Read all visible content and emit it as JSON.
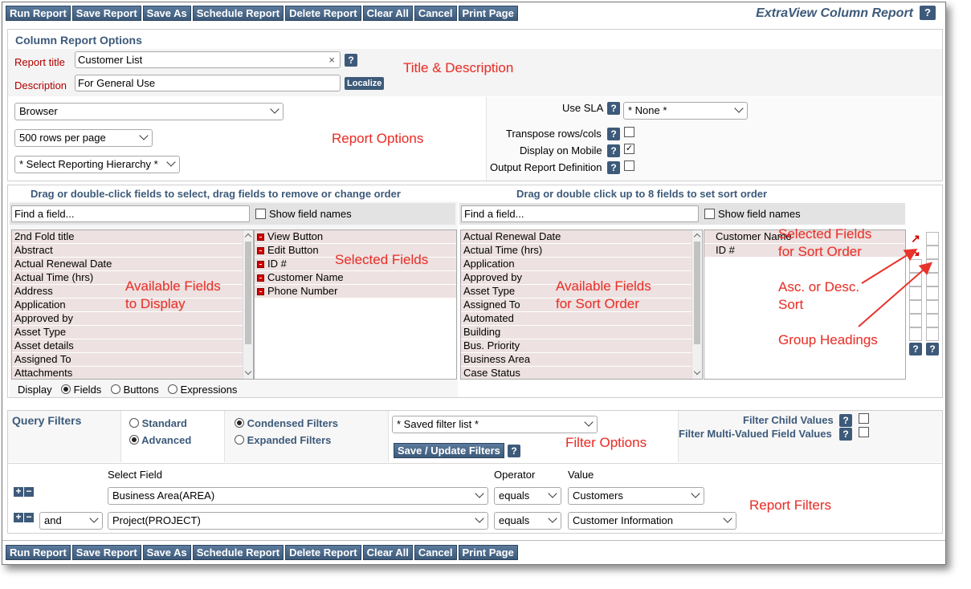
{
  "toolbar": {
    "buttons": [
      "Run Report",
      "Save Report",
      "Save As",
      "Schedule Report",
      "Delete Report",
      "Clear All",
      "Cancel",
      "Print Page"
    ]
  },
  "page_title": "ExtraView Column Report",
  "help_label": "?",
  "options": {
    "title": "Column Report Options",
    "report_title_label": "Report title",
    "report_title_value": "Customer List",
    "description_label": "Description",
    "description_value": "For General Use",
    "localize_label": "Localize",
    "output_select": "Browser",
    "rows_select": "500 rows per page",
    "hierarchy_select": "* Select Reporting Hierarchy *",
    "use_sla_label": "Use SLA",
    "use_sla_value": "* None *",
    "transpose_label": "Transpose rows/cols",
    "mobile_label": "Display on Mobile",
    "output_def_label": "Output Report Definition"
  },
  "fields": {
    "left_heading": "Drag or double-click fields to select, drag fields to remove or change order",
    "right_heading": "Drag or double click up to 8 fields to set sort order",
    "find_placeholder": "Find a field...",
    "show_names_label": "Show field names",
    "available": [
      "2nd Fold title",
      "Abstract",
      "Actual Renewal Date",
      "Actual Time (hrs)",
      "Address",
      "Application",
      "Approved by",
      "Asset Type",
      "Asset details",
      "Assigned To",
      "Attachments"
    ],
    "selected": [
      "View Button",
      "Edit Button",
      "ID #",
      "Customer Name",
      "Phone Number"
    ],
    "sort_available": [
      "Actual Renewal Date",
      "Actual Time (hrs)",
      "Application",
      "Approved by",
      "Asset Type",
      "Assigned To",
      "Automated",
      "Building",
      "Bus. Priority",
      "Business Area",
      "Case Status"
    ],
    "sort_selected": [
      "Customer Name",
      "ID #"
    ],
    "display_label": "Display",
    "display_options": [
      "Fields",
      "Buttons",
      "Expressions"
    ]
  },
  "filters": {
    "title": "Query Filters",
    "standard_label": "Standard",
    "advanced_label": "Advanced",
    "condensed_label": "Condensed Filters",
    "expanded_label": "Expanded Filters",
    "saved_filter_select": "* Saved filter list *",
    "save_update_label": "Save / Update Filters",
    "child_values_label": "Filter Child Values",
    "multi_valued_label": "Filter Multi-Valued Field Values",
    "col_select_field": "Select Field",
    "col_operator": "Operator",
    "col_value": "Value",
    "rows": [
      {
        "conj": "",
        "field": "Business Area(AREA)",
        "operator": "equals",
        "value": "Customers"
      },
      {
        "conj": "and",
        "field": "Project(PROJECT)",
        "operator": "equals",
        "value": "Customer Information"
      }
    ]
  },
  "annotations": {
    "title_desc": "Title & Description",
    "report_options": "Report Options",
    "selected_fields": "Selected Fields",
    "available_display_1": "Available Fields",
    "available_display_2": "to Display",
    "available_sort_1": "Available Fields",
    "available_sort_2": "for Sort Order",
    "selected_sort_1": "Selected Fields",
    "selected_sort_2": "for Sort Order",
    "asc_desc_1": "Asc. or Desc.",
    "asc_desc_2": "Sort",
    "group_headings": "Group Headings",
    "filter_options": "Filter Options",
    "report_filters": "Report Filters"
  },
  "colors": {
    "accent": "#3d5a7a",
    "annotation": "#e8332b",
    "list_item": "#ede1e1",
    "label_red": "#b00000"
  },
  "icons": [
    "help-icon",
    "clear-icon",
    "remove-field-icon",
    "sort-ascending-icon",
    "sort-descending-icon",
    "add-filter-icon",
    "remove-filter-icon",
    "chevron-down-icon"
  ]
}
